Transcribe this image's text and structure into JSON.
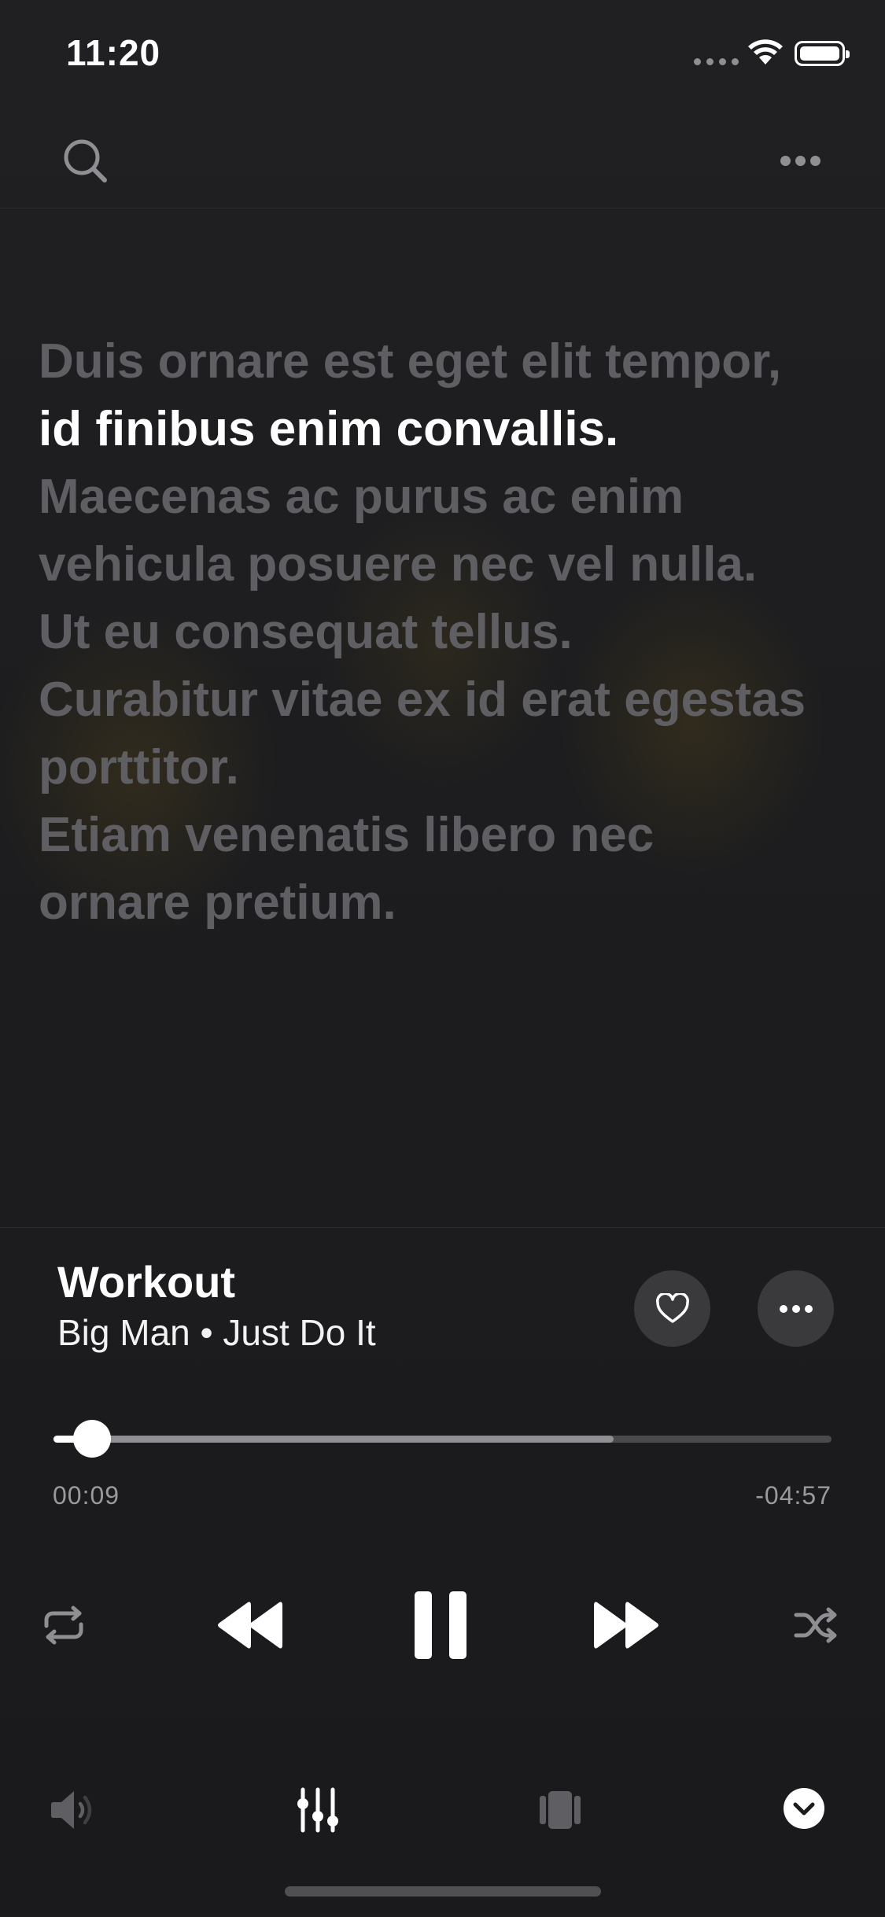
{
  "status_bar": {
    "time": "11:20",
    "battery_level": 1.0
  },
  "lyrics": {
    "lines": [
      "Duis ornare est eget elit tempor,",
      "id finibus enim convallis.",
      "Maecenas ac purus ac enim",
      "vehicula posuere nec vel nulla.",
      "Ut eu consequat tellus.",
      "Curabitur vitae ex id erat egestas",
      "porttitor.",
      "Etiam venenatis libero nec",
      "ornare pretium."
    ],
    "active_index": 1
  },
  "now_playing": {
    "title": "Workout",
    "subtitle": "Big Man • Just Do It",
    "elapsed": "00:09",
    "remaining": "-04:57",
    "progress": 0.05,
    "buffered": 0.72
  },
  "icons": {
    "search": "search-icon",
    "more": "ellipsis-icon",
    "like": "heart-icon",
    "repeat": "repeat-icon",
    "previous": "rewind-icon",
    "play_pause": "pause-icon",
    "next": "fast-forward-icon",
    "shuffle": "shuffle-icon",
    "volume": "speaker-icon",
    "equalizer": "equalizer-icon",
    "queue": "cards-icon",
    "collapse": "chevron-down-icon"
  },
  "colors": {
    "background": "#1c1c1e",
    "active_lyric": "#ffffff",
    "inactive_lyric": "#5f5f63",
    "accent": "#ffffff"
  }
}
